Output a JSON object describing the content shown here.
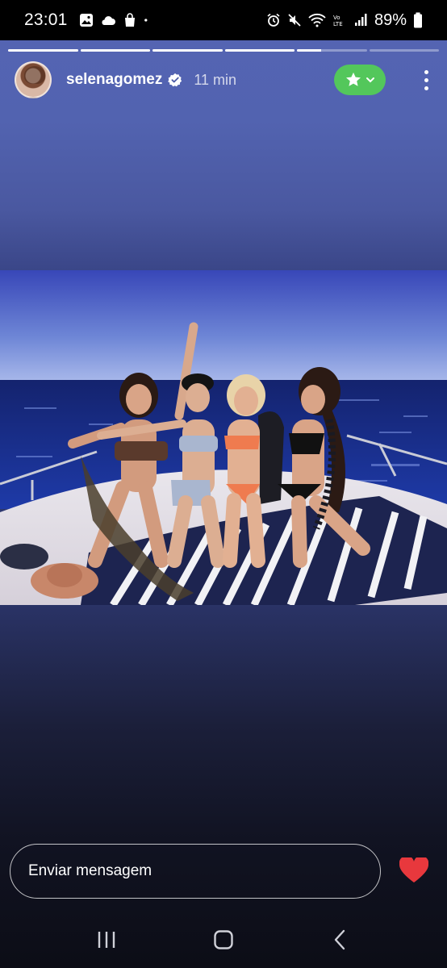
{
  "status_bar": {
    "time": "23:01",
    "battery": "89%",
    "left_icons": [
      "gallery-icon",
      "cloud-icon",
      "shopping-bag-icon",
      "dot-icon"
    ],
    "right_icons": [
      "alarm-icon",
      "mute-icon",
      "wifi-icon",
      "volte-icon",
      "signal-icon",
      "battery-icon"
    ]
  },
  "story": {
    "segments": 6,
    "progress": [
      1,
      1,
      1,
      1,
      0.35,
      0
    ],
    "username": "selenagomez",
    "verified": true,
    "timestamp": "11 min",
    "close_friends_icon": "star-icon",
    "more_icon": "more-vertical-icon"
  },
  "reply": {
    "placeholder": "Enviar mensagem",
    "like_icon": "heart-icon"
  },
  "nav": {
    "items": [
      "recents-icon",
      "home-icon",
      "back-icon"
    ]
  },
  "colors": {
    "accent_green": "#53c75b",
    "heart_red": "#e8383d",
    "verified_blue": "#ffffff"
  }
}
